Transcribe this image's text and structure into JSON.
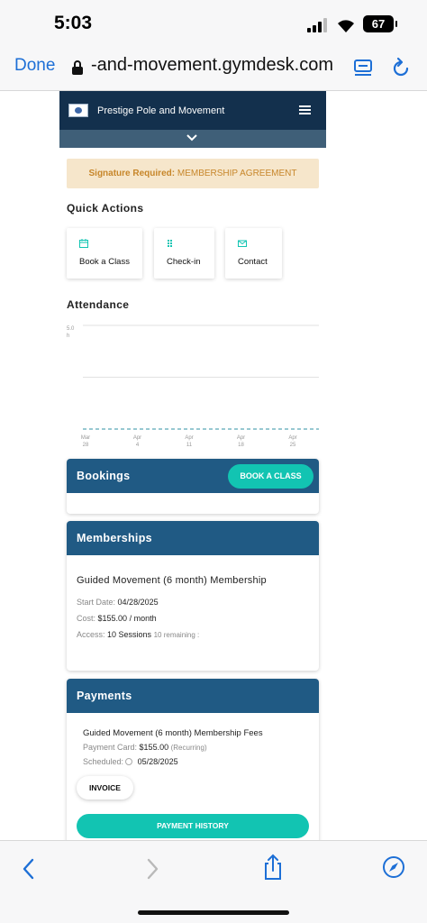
{
  "status_bar": {
    "time": "5:03",
    "battery": "67"
  },
  "browser": {
    "done_label": "Done",
    "url": "-and-movement.gymdesk.com"
  },
  "site": {
    "name": "Prestige Pole and Movement"
  },
  "alert": {
    "strong": "Signature Required:",
    "text": "MEMBERSHIP AGREEMENT"
  },
  "quick_actions": {
    "title": "Quick Actions",
    "items": [
      {
        "label": "Book a Class",
        "icon": "calendar-icon"
      },
      {
        "label": "Check-in",
        "icon": "grid-icon"
      },
      {
        "label": "Contact",
        "icon": "envelope-icon"
      }
    ]
  },
  "attendance": {
    "title": "Attendance"
  },
  "chart_data": {
    "type": "line",
    "title": "Attendance",
    "y_tick_labels": [
      "5.0",
      "h"
    ],
    "ylim": [
      0,
      5.0
    ],
    "x_tick_labels": [
      [
        "Mar",
        "28"
      ],
      [
        "Apr",
        "4"
      ],
      [
        "Apr",
        "11"
      ],
      [
        "Apr",
        "18"
      ],
      [
        "Apr",
        "25"
      ]
    ],
    "series": [
      {
        "values": [
          0,
          0,
          0,
          0,
          0
        ]
      }
    ],
    "grid": true,
    "colors": {
      "line": "#5aa8b6",
      "grid": "#e2e2e2"
    }
  },
  "bookings": {
    "title": "Bookings",
    "button": "BOOK A CLASS"
  },
  "memberships": {
    "title": "Memberships",
    "name": "Guided Movement (6 month) Membership",
    "start_label": "Start Date:",
    "start_value": "04/28/2025",
    "cost_label": "Cost:",
    "cost_value": "$155.00 / month",
    "access_label": "Access:",
    "access_value": "10 Sessions",
    "access_note": "10 remaining :"
  },
  "payments": {
    "title": "Payments",
    "name": "Guided Movement (6 month) Membership Fees",
    "card_label": "Payment Card:",
    "card_value": "$155.00",
    "card_note": "(Recurring)",
    "scheduled_label": "Scheduled:",
    "scheduled_value": "05/28/2025",
    "invoice_button": "INVOICE",
    "history_button": "PAYMENT HISTORY"
  },
  "colors": {
    "accent": "#12c4b2",
    "panel_header": "#205a84",
    "site_header": "#13304d",
    "link": "#1d6fd6"
  }
}
